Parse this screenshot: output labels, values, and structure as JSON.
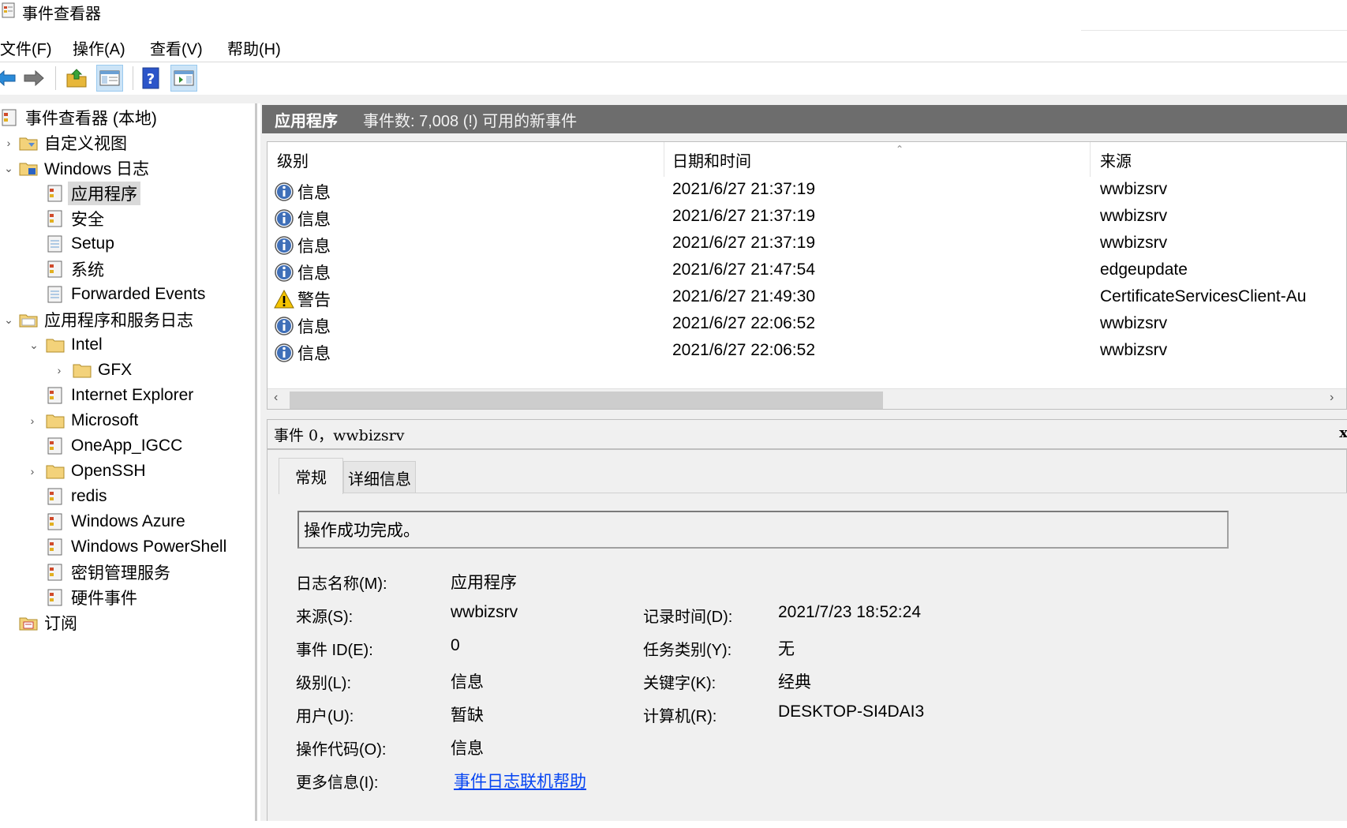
{
  "window": {
    "title": "事件查看器"
  },
  "menu": [
    "文件(F)",
    "操作(A)",
    "查看(V)",
    "帮助(H)"
  ],
  "toolbar": {
    "buttons": [
      "back-arrow-icon",
      "forward-arrow-icon",
      "up-folder-icon",
      "show-hide-console-tree-icon",
      "help-icon",
      "show-hide-action-pane-icon"
    ]
  },
  "tree": {
    "root": "事件查看器 (本地)",
    "custom_views": "自定义视图",
    "windows_logs": "Windows 日志",
    "application": "应用程序",
    "security": "安全",
    "setup": "Setup",
    "system": "系统",
    "forwarded": "Forwarded Events",
    "app_service_logs": "应用程序和服务日志",
    "intel": "Intel",
    "gfx": "GFX",
    "ie": "Internet Explorer",
    "microsoft": "Microsoft",
    "oneapp": "OneApp_IGCC",
    "openssh": "OpenSSH",
    "redis": "redis",
    "azure": "Windows Azure",
    "powershell": "Windows PowerShell",
    "kms": "密钥管理服务",
    "hardware": "硬件事件",
    "subscriptions": "订阅"
  },
  "header": {
    "title": "应用程序",
    "count": "事件数: 7,008 (!) 可用的新事件"
  },
  "columns": {
    "level": "级别",
    "datetime": "日期和时间",
    "source": "来源"
  },
  "events": [
    {
      "level": "信息",
      "type": "info",
      "datetime": "2021/6/27 21:37:19",
      "source": "wwbizsrv"
    },
    {
      "level": "信息",
      "type": "info",
      "datetime": "2021/6/27 21:37:19",
      "source": "wwbizsrv"
    },
    {
      "level": "信息",
      "type": "info",
      "datetime": "2021/6/27 21:37:19",
      "source": "wwbizsrv"
    },
    {
      "level": "信息",
      "type": "info",
      "datetime": "2021/6/27 21:47:54",
      "source": "edgeupdate"
    },
    {
      "level": "警告",
      "type": "warning",
      "datetime": "2021/6/27 21:49:30",
      "source": "CertificateServicesClient-Au"
    },
    {
      "level": "信息",
      "type": "info",
      "datetime": "2021/6/27 22:06:52",
      "source": "wwbizsrv"
    },
    {
      "level": "信息",
      "type": "info",
      "datetime": "2021/6/27 22:06:52",
      "source": "wwbizsrv"
    }
  ],
  "detail": {
    "title": "事件 0，wwbizsrv",
    "tabs": [
      "常规",
      "详细信息"
    ],
    "message": "操作成功完成。",
    "labels": {
      "log_name": "日志名称(M):",
      "source": "来源(S):",
      "event_id": "事件 ID(E):",
      "level": "级别(L):",
      "user": "用户(U):",
      "opcode": "操作代码(O):",
      "more_info": "更多信息(I):",
      "logged": "记录时间(D):",
      "task": "任务类别(Y):",
      "keywords": "关键字(K):",
      "computer": "计算机(R):"
    },
    "values": {
      "log_name": "应用程序",
      "source": "wwbizsrv",
      "event_id": "0",
      "level": "信息",
      "user": "暂缺",
      "opcode": "信息",
      "more_info": "事件日志联机帮助",
      "logged": "2021/7/23 18:52:24",
      "task": "无",
      "keywords": "经典",
      "computer": "DESKTOP-SI4DAI3"
    }
  }
}
